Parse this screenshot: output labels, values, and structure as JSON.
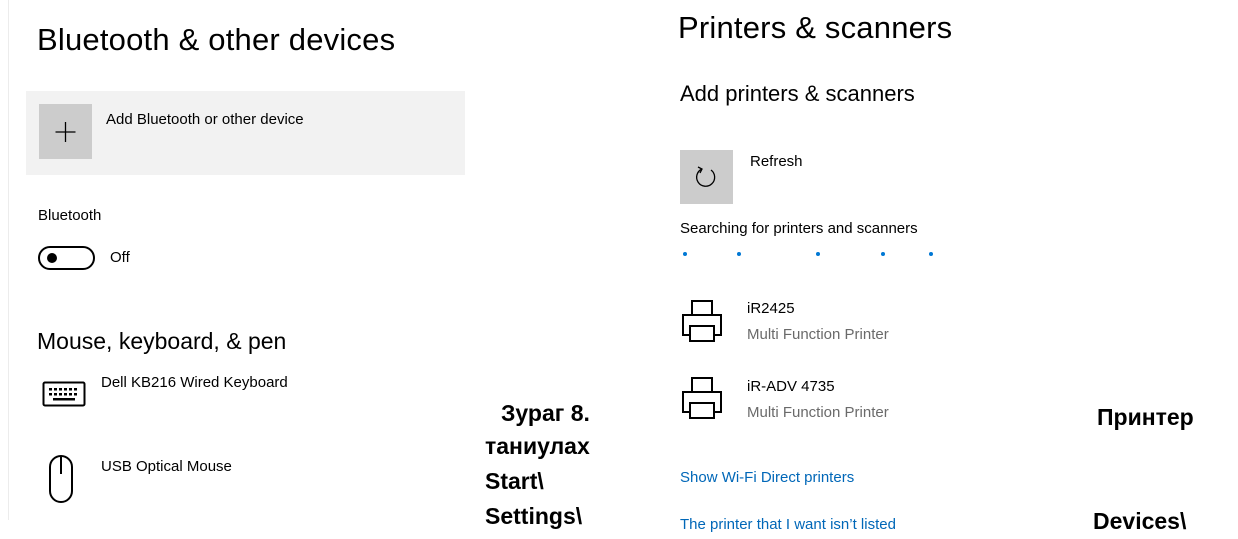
{
  "bluetooth_section": {
    "title": "Bluetooth & other devices",
    "add_device_label": "Add Bluetooth or other device",
    "bluetooth_label": "Bluetooth",
    "toggle_state": "Off",
    "mouse_section_title": "Mouse, keyboard, & pen",
    "devices": [
      {
        "name": "Dell KB216 Wired Keyboard",
        "icon": "keyboard-icon"
      },
      {
        "name": "USB Optical Mouse",
        "icon": "mouse-icon"
      }
    ]
  },
  "printers_section": {
    "title": "Printers & scanners",
    "add_title": "Add printers & scanners",
    "refresh_label": "Refresh",
    "searching_text": "Searching for printers and scanners",
    "printers": [
      {
        "name": "iR2425",
        "type": "Multi Function Printer",
        "icon": "printer-icon"
      },
      {
        "name": "iR-ADV 4735",
        "type": "Multi Function Printer",
        "icon": "printer-icon"
      }
    ],
    "show_wifi_direct": "Show Wi-Fi Direct printers",
    "not_listed": "The printer that I want isn’t listed"
  },
  "caption": {
    "middle_lines": [
      "Зураг 8.",
      "таниулах",
      "Start\\",
      "Settings\\"
    ],
    "right_lines": [
      "Принтер",
      "Devices\\"
    ]
  },
  "colors": {
    "link": "#0067b8",
    "progress_dots": "#0078d4",
    "tile": "#cccccc",
    "card": "#f2f2f2"
  }
}
